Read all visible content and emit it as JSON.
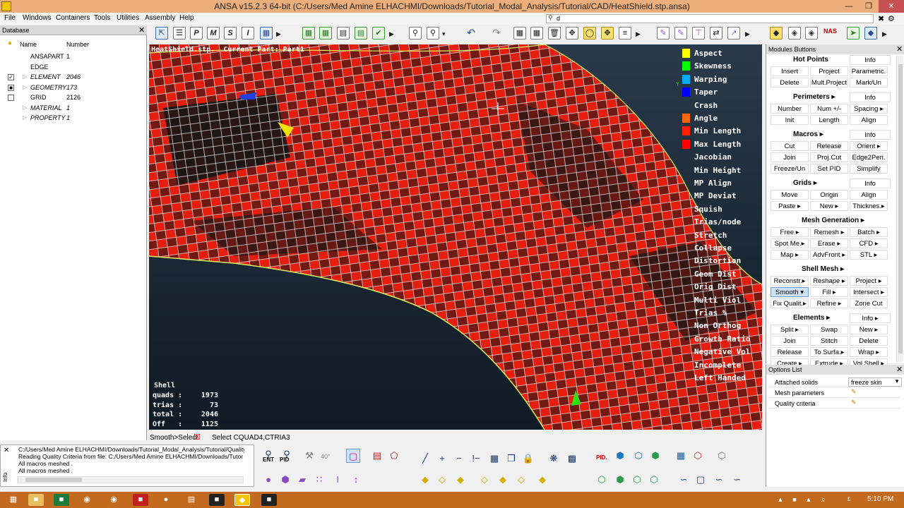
{
  "window": {
    "title": "ANSA v15.2.3 64-bit (C:/Users/Med Amine ELHACHMI/Downloads/Tutorial_Modal_Analysis/Tutorial/CAD/HeatShield.stp.ansa)"
  },
  "menu": [
    "File",
    "Windows",
    "Containers",
    "Tools",
    "Utilities",
    "Assembly",
    "Help"
  ],
  "search": {
    "value": "d"
  },
  "database": {
    "title": "Database",
    "col_name": "Name",
    "col_number": "Number",
    "rows": [
      {
        "name": "ANSAPART",
        "value": "1",
        "italic": false,
        "check": ""
      },
      {
        "name": "EDGE",
        "value": "",
        "italic": false,
        "check": ""
      },
      {
        "name": "ELEMENT",
        "value": "2046",
        "italic": true,
        "check": "✓"
      },
      {
        "name": "GEOMETRY",
        "value": "173",
        "italic": true,
        "check": "■"
      },
      {
        "name": "GRID",
        "value": "2126",
        "italic": false,
        "check": " "
      },
      {
        "name": "MATERIAL",
        "value": "1",
        "italic": true,
        "check": ""
      },
      {
        "name": "PROPERTY",
        "value": "1",
        "italic": true,
        "check": ""
      }
    ]
  },
  "viewport": {
    "header": "HeatShield.stp.  Current Part: Part1",
    "legend": [
      {
        "label": "Aspect",
        "color": "#ffff00"
      },
      {
        "label": "Skewness",
        "color": "#00ff00"
      },
      {
        "label": "Warping",
        "color": "#00aaff"
      },
      {
        "label": "Taper",
        "color": "#0000ff"
      },
      {
        "label": "Crash",
        "color": ""
      },
      {
        "label": "Angle",
        "color": "#ff6600"
      },
      {
        "label": "Min Length",
        "color": "#ff2000"
      },
      {
        "label": "Max Length",
        "color": "#ff0000"
      },
      {
        "label": "Jacobian",
        "color": ""
      },
      {
        "label": "Min Height",
        "color": ""
      },
      {
        "label": "MP Align",
        "color": ""
      },
      {
        "label": "MP Deviat",
        "color": ""
      },
      {
        "label": "Squish",
        "color": ""
      },
      {
        "label": "Trias/node",
        "color": ""
      },
      {
        "label": "Stretch",
        "color": ""
      },
      {
        "label": "Collapse",
        "color": ""
      },
      {
        "label": "Distortion",
        "color": ""
      },
      {
        "label": "Geom Dist",
        "color": ""
      },
      {
        "label": "Orig Dist",
        "color": ""
      },
      {
        "label": "Multi Viol",
        "color": ""
      },
      {
        "label": "Trias %",
        "color": ""
      },
      {
        "label": "Non Orthog",
        "color": ""
      },
      {
        "label": "Growth Ratio",
        "color": ""
      },
      {
        "label": "Negative Vol",
        "color": ""
      },
      {
        "label": "Incomplete",
        "color": ""
      },
      {
        "label": "Left Handed",
        "color": ""
      }
    ],
    "stats": {
      "title": "Shell",
      "rows": [
        {
          "label": "quads :",
          "value": "1973"
        },
        {
          "label": "trias :",
          "value": "73"
        },
        {
          "label": "total :",
          "value": "2046"
        },
        {
          "label": "Off   :",
          "value": "1125"
        }
      ]
    }
  },
  "modules": {
    "title": "Modules Buttons",
    "sections": [
      {
        "name": "Hot Points",
        "rows": [
          [
            "Info"
          ],
          [
            "Insert",
            "Project",
            "Parametric."
          ],
          [
            "Delete",
            "Mult.Project",
            "Mark/Un"
          ]
        ]
      },
      {
        "name": "Perimeters ▸",
        "rows": [
          [
            "Info"
          ],
          [
            "Number",
            "Num +/-",
            "Spacing ▸"
          ],
          [
            "Init",
            "Length",
            "Align"
          ]
        ]
      },
      {
        "name": "Macros ▸",
        "rows": [
          [
            "Info"
          ],
          [
            "Cut",
            "Release",
            "Orient ▸"
          ],
          [
            "Join",
            "Proj.Cut",
            "Edge2Peri."
          ],
          [
            "Freeze/Un",
            "Set PID",
            "Simplify"
          ]
        ]
      },
      {
        "name": "Grids ▸",
        "rows": [
          [
            "Info"
          ],
          [
            "Move",
            "Origin",
            "Align"
          ],
          [
            "Paste ▸",
            "New ▸",
            "Thicknes.▸"
          ]
        ]
      },
      {
        "name": "Mesh Generation ▸",
        "rows": [
          [
            "Free ▸",
            "Remesh ▸",
            "Batch ▸"
          ],
          [
            "Spot Me.▸",
            "Erase ▸",
            "CFD ▸"
          ],
          [
            "Map ▸",
            "AdvFront ▸",
            "STL ▸"
          ]
        ]
      },
      {
        "name": "Shell Mesh ▸",
        "rows": [
          [
            "Reconstr.▸",
            "Reshape ▸",
            "Project ▸"
          ],
          [
            "Smooth ▾",
            "Fill ▸",
            "Intersect ▸"
          ],
          [
            "Fix Qualit.▸",
            "Refine ▸",
            "Zone Cut"
          ]
        ]
      },
      {
        "name": "Elements ▸",
        "rows": [
          [
            "Info ▸"
          ],
          [
            "Split ▸",
            "Swap",
            "New ▸"
          ],
          [
            "Join",
            "Stitch",
            "Delete"
          ],
          [
            "Release",
            "To Surfa.▸",
            "Wrap ▸"
          ],
          [
            "Create ▸",
            "Extrude ▸",
            "Vol.Shell ▸"
          ]
        ]
      }
    ]
  },
  "options": {
    "title": "Options List",
    "rows": [
      {
        "label": "Attached solids",
        "value": "freeze skin"
      },
      {
        "label": "Mesh parameters",
        "value": ""
      },
      {
        "label": "Quality criteria",
        "value": ""
      }
    ]
  },
  "status": {
    "mode": "Smooth>Select",
    "message": "Select CQUAD4,CTRIA3"
  },
  "info": {
    "tab": "Info",
    "lines": [
      "C:/Users/Med Amine ELHACHMI/Downloads/Tutorial_Modal_Analysis/Tutorial/Quality",
      "Reading Quality Criteria from file: C:/Users/Med Amine ELHACHMI/Downloads/Tutor",
      "  All macros meshed .",
      "  All macros meshed ."
    ]
  },
  "bottom_toolbar": {
    "ent": "ENT",
    "pid": "PID",
    "angle": "40°",
    "pid2": "PID."
  },
  "taskbar": {
    "lang": "ε",
    "clock": "5:10 PM"
  }
}
